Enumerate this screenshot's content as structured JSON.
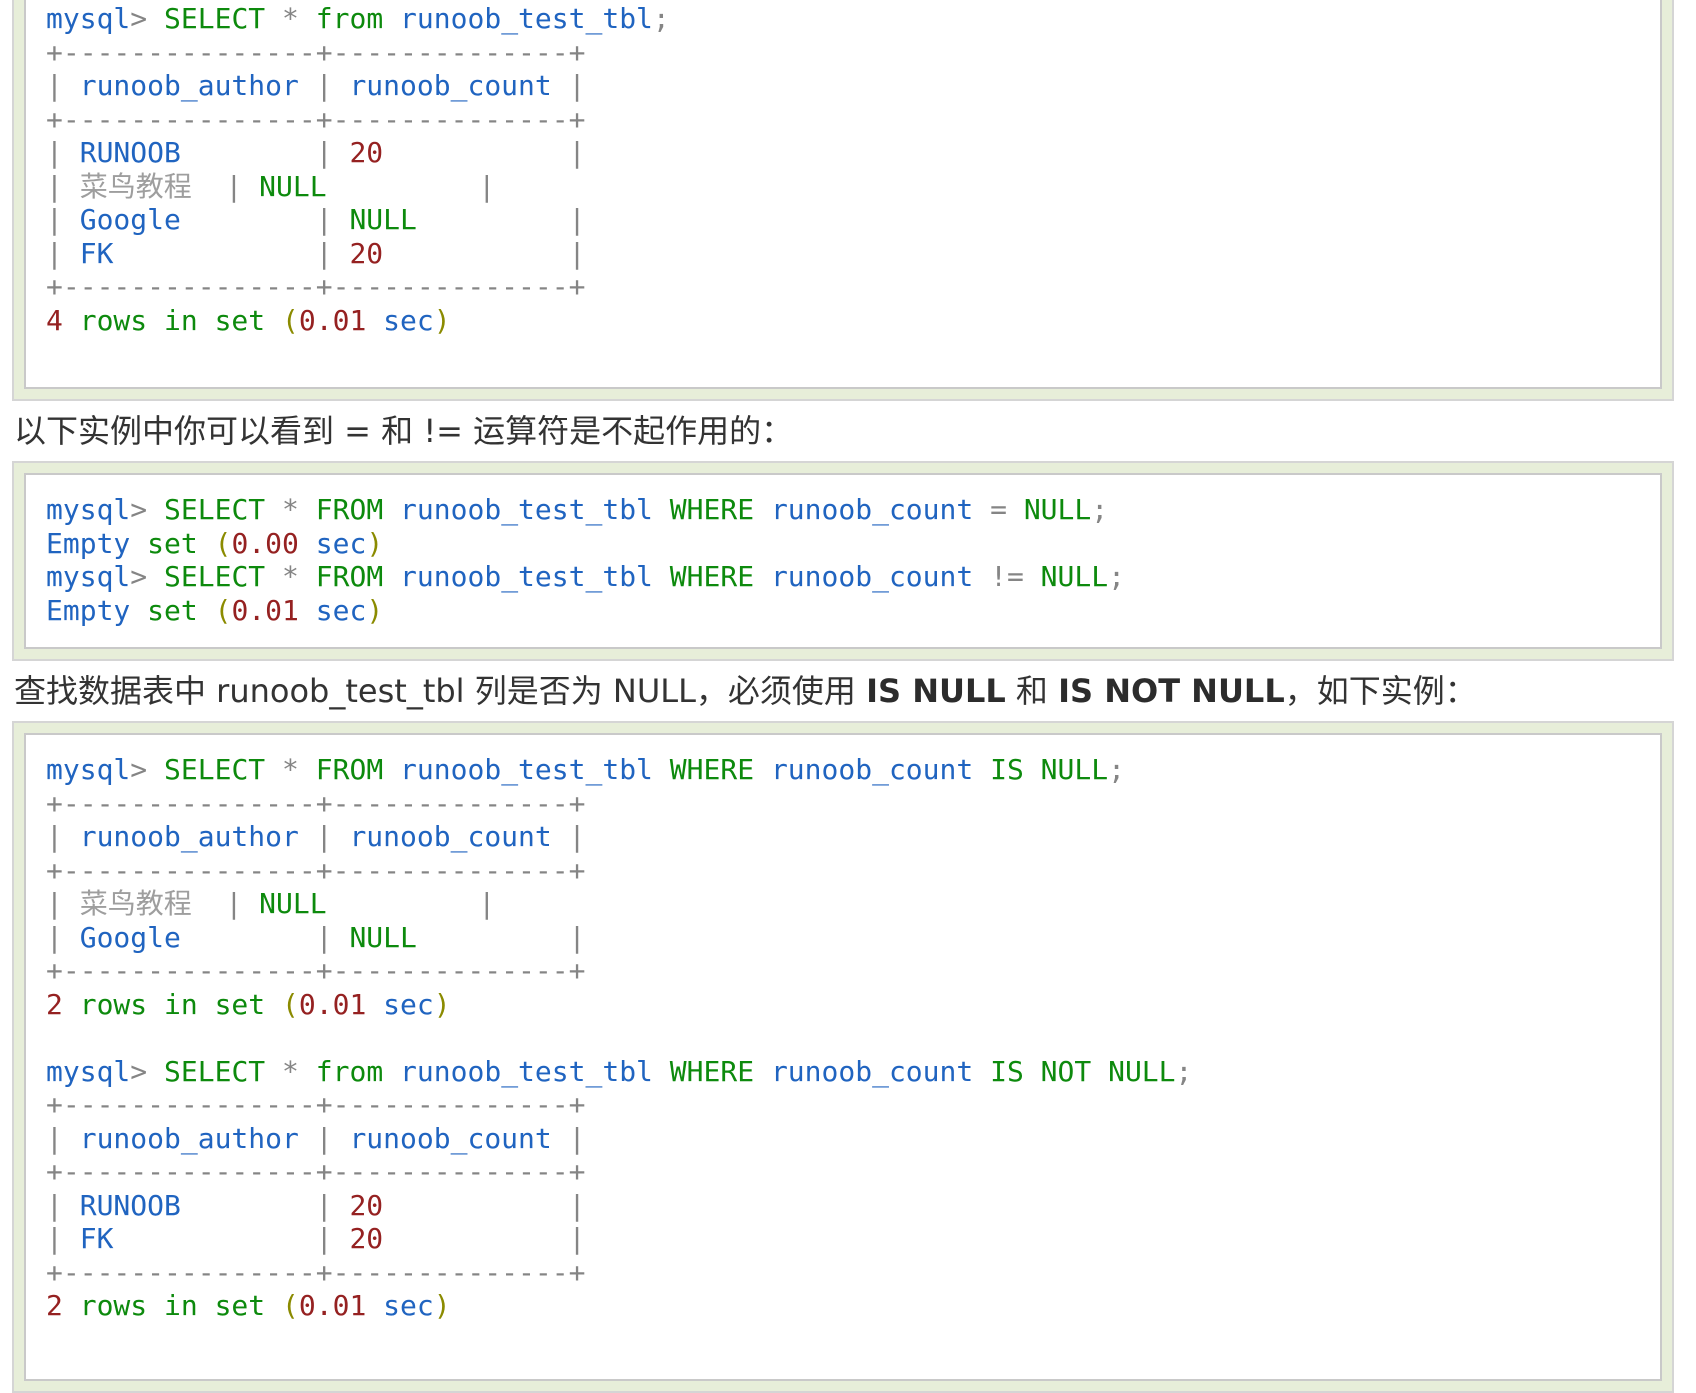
{
  "colors": {
    "identifier_blue": "#2064c0",
    "keyword_green": "#0d8a0d",
    "number_red": "#952121",
    "paren_olive": "#8b8b00",
    "punct_gray": "#858585",
    "cjk_gray": "#9e9e9e",
    "box_bg": "#e7eed9",
    "box_border": "#d5d5d5",
    "pre_border": "#c9c9c9"
  },
  "paragraphs": {
    "operators_note": [
      {
        "t": "以下实例中你可以看到 = 和 != 运算符是不起作用的："
      }
    ],
    "isnull_note": [
      {
        "t": "查找数据表中 runoob_test_tbl 列是否为 NULL，必须使用 "
      },
      {
        "t": "IS NULL",
        "b": true
      },
      {
        "t": " 和 "
      },
      {
        "t": "IS NOT NULL",
        "b": true
      },
      {
        "t": "，如下实例："
      }
    ]
  },
  "code_blocks": [
    {
      "name": "mysql-output-select-all",
      "lines": [
        [
          {
            "c": "b",
            "t": "mysql"
          },
          {
            "c": "p",
            "t": "> "
          },
          {
            "c": "g",
            "t": "SELECT"
          },
          {
            "c": "p",
            "t": " * "
          },
          {
            "c": "g",
            "t": "from"
          },
          {
            "c": "p",
            "t": " "
          },
          {
            "c": "b",
            "t": "runoob_test_tbl"
          },
          {
            "c": "p",
            "t": ";"
          }
        ],
        [
          {
            "c": "p",
            "t": "+---------------+--------------+"
          }
        ],
        [
          {
            "c": "p",
            "t": "| "
          },
          {
            "c": "b",
            "t": "runoob_author"
          },
          {
            "c": "p",
            "t": " | "
          },
          {
            "c": "b",
            "t": "runoob_count"
          },
          {
            "c": "p",
            "t": " |"
          }
        ],
        [
          {
            "c": "p",
            "t": "+---------------+--------------+"
          }
        ],
        [
          {
            "c": "p",
            "t": "| "
          },
          {
            "c": "b",
            "t": "RUNOOB"
          },
          {
            "c": "p",
            "t": "        | "
          },
          {
            "c": "r",
            "t": "20"
          },
          {
            "c": "p",
            "t": "           |"
          }
        ],
        [
          {
            "c": "p",
            "t": "| "
          },
          {
            "c": "y",
            "t": "菜鸟教程"
          },
          {
            "c": "p",
            "t": "  | "
          },
          {
            "c": "g",
            "t": "NULL"
          },
          {
            "c": "p",
            "t": "         |"
          }
        ],
        [
          {
            "c": "p",
            "t": "| "
          },
          {
            "c": "b",
            "t": "Google"
          },
          {
            "c": "p",
            "t": "        | "
          },
          {
            "c": "g",
            "t": "NULL"
          },
          {
            "c": "p",
            "t": "         |"
          }
        ],
        [
          {
            "c": "p",
            "t": "| "
          },
          {
            "c": "b",
            "t": "FK"
          },
          {
            "c": "p",
            "t": "            | "
          },
          {
            "c": "r",
            "t": "20"
          },
          {
            "c": "p",
            "t": "           |"
          }
        ],
        [
          {
            "c": "p",
            "t": "+---------------+--------------+"
          }
        ],
        [
          {
            "c": "r",
            "t": "4"
          },
          {
            "c": "g",
            "t": " rows in set "
          },
          {
            "c": "o",
            "t": "("
          },
          {
            "c": "r",
            "t": "0.01"
          },
          {
            "c": "b",
            "t": " sec"
          },
          {
            "c": "o",
            "t": ")"
          }
        ]
      ]
    },
    {
      "name": "mysql-output-equal-null",
      "lines": [
        [
          {
            "c": "b",
            "t": "mysql"
          },
          {
            "c": "p",
            "t": "> "
          },
          {
            "c": "g",
            "t": "SELECT"
          },
          {
            "c": "p",
            "t": " * "
          },
          {
            "c": "g",
            "t": "FROM"
          },
          {
            "c": "p",
            "t": " "
          },
          {
            "c": "b",
            "t": "runoob_test_tbl"
          },
          {
            "c": "p",
            "t": " "
          },
          {
            "c": "g",
            "t": "WHERE"
          },
          {
            "c": "p",
            "t": " "
          },
          {
            "c": "b",
            "t": "runoob_count"
          },
          {
            "c": "p",
            "t": " = "
          },
          {
            "c": "g",
            "t": "NULL"
          },
          {
            "c": "p",
            "t": ";"
          }
        ],
        [
          {
            "c": "b",
            "t": "Empty"
          },
          {
            "c": "g",
            "t": " set "
          },
          {
            "c": "o",
            "t": "("
          },
          {
            "c": "r",
            "t": "0.00"
          },
          {
            "c": "b",
            "t": " sec"
          },
          {
            "c": "o",
            "t": ")"
          }
        ],
        [
          {
            "c": "b",
            "t": "mysql"
          },
          {
            "c": "p",
            "t": "> "
          },
          {
            "c": "g",
            "t": "SELECT"
          },
          {
            "c": "p",
            "t": " * "
          },
          {
            "c": "g",
            "t": "FROM"
          },
          {
            "c": "p",
            "t": " "
          },
          {
            "c": "b",
            "t": "runoob_test_tbl"
          },
          {
            "c": "p",
            "t": " "
          },
          {
            "c": "g",
            "t": "WHERE"
          },
          {
            "c": "p",
            "t": " "
          },
          {
            "c": "b",
            "t": "runoob_count"
          },
          {
            "c": "p",
            "t": " != "
          },
          {
            "c": "g",
            "t": "NULL"
          },
          {
            "c": "p",
            "t": ";"
          }
        ],
        [
          {
            "c": "b",
            "t": "Empty"
          },
          {
            "c": "g",
            "t": " set "
          },
          {
            "c": "o",
            "t": "("
          },
          {
            "c": "r",
            "t": "0.01"
          },
          {
            "c": "b",
            "t": " sec"
          },
          {
            "c": "o",
            "t": ")"
          }
        ]
      ]
    },
    {
      "name": "mysql-output-is-null",
      "lines": [
        [
          {
            "c": "b",
            "t": "mysql"
          },
          {
            "c": "p",
            "t": "> "
          },
          {
            "c": "g",
            "t": "SELECT"
          },
          {
            "c": "p",
            "t": " * "
          },
          {
            "c": "g",
            "t": "FROM"
          },
          {
            "c": "p",
            "t": " "
          },
          {
            "c": "b",
            "t": "runoob_test_tbl"
          },
          {
            "c": "p",
            "t": " "
          },
          {
            "c": "g",
            "t": "WHERE"
          },
          {
            "c": "p",
            "t": " "
          },
          {
            "c": "b",
            "t": "runoob_count"
          },
          {
            "c": "p",
            "t": " "
          },
          {
            "c": "g",
            "t": "IS NULL"
          },
          {
            "c": "p",
            "t": ";"
          }
        ],
        [
          {
            "c": "p",
            "t": "+---------------+--------------+"
          }
        ],
        [
          {
            "c": "p",
            "t": "| "
          },
          {
            "c": "b",
            "t": "runoob_author"
          },
          {
            "c": "p",
            "t": " | "
          },
          {
            "c": "b",
            "t": "runoob_count"
          },
          {
            "c": "p",
            "t": " |"
          }
        ],
        [
          {
            "c": "p",
            "t": "+---------------+--------------+"
          }
        ],
        [
          {
            "c": "p",
            "t": "| "
          },
          {
            "c": "y",
            "t": "菜鸟教程"
          },
          {
            "c": "p",
            "t": "  | "
          },
          {
            "c": "g",
            "t": "NULL"
          },
          {
            "c": "p",
            "t": "         |"
          }
        ],
        [
          {
            "c": "p",
            "t": "| "
          },
          {
            "c": "b",
            "t": "Google"
          },
          {
            "c": "p",
            "t": "        | "
          },
          {
            "c": "g",
            "t": "NULL"
          },
          {
            "c": "p",
            "t": "         |"
          }
        ],
        [
          {
            "c": "p",
            "t": "+---------------+--------------+"
          }
        ],
        [
          {
            "c": "r",
            "t": "2"
          },
          {
            "c": "g",
            "t": " rows in set "
          },
          {
            "c": "o",
            "t": "("
          },
          {
            "c": "r",
            "t": "0.01"
          },
          {
            "c": "b",
            "t": " sec"
          },
          {
            "c": "o",
            "t": ")"
          }
        ],
        [],
        [
          {
            "c": "b",
            "t": "mysql"
          },
          {
            "c": "p",
            "t": "> "
          },
          {
            "c": "g",
            "t": "SELECT"
          },
          {
            "c": "p",
            "t": " * "
          },
          {
            "c": "g",
            "t": "from"
          },
          {
            "c": "p",
            "t": " "
          },
          {
            "c": "b",
            "t": "runoob_test_tbl"
          },
          {
            "c": "p",
            "t": " "
          },
          {
            "c": "g",
            "t": "WHERE"
          },
          {
            "c": "p",
            "t": " "
          },
          {
            "c": "b",
            "t": "runoob_count"
          },
          {
            "c": "p",
            "t": " "
          },
          {
            "c": "g",
            "t": "IS NOT NULL"
          },
          {
            "c": "p",
            "t": ";"
          }
        ],
        [
          {
            "c": "p",
            "t": "+---------------+--------------+"
          }
        ],
        [
          {
            "c": "p",
            "t": "| "
          },
          {
            "c": "b",
            "t": "runoob_author"
          },
          {
            "c": "p",
            "t": " | "
          },
          {
            "c": "b",
            "t": "runoob_count"
          },
          {
            "c": "p",
            "t": " |"
          }
        ],
        [
          {
            "c": "p",
            "t": "+---------------+--------------+"
          }
        ],
        [
          {
            "c": "p",
            "t": "| "
          },
          {
            "c": "b",
            "t": "RUNOOB"
          },
          {
            "c": "p",
            "t": "        | "
          },
          {
            "c": "r",
            "t": "20"
          },
          {
            "c": "p",
            "t": "           |"
          }
        ],
        [
          {
            "c": "p",
            "t": "| "
          },
          {
            "c": "b",
            "t": "FK"
          },
          {
            "c": "p",
            "t": "            | "
          },
          {
            "c": "r",
            "t": "20"
          },
          {
            "c": "p",
            "t": "           |"
          }
        ],
        [
          {
            "c": "p",
            "t": "+---------------+--------------+"
          }
        ],
        [
          {
            "c": "r",
            "t": "2"
          },
          {
            "c": "g",
            "t": " rows in set "
          },
          {
            "c": "o",
            "t": "("
          },
          {
            "c": "r",
            "t": "0.01"
          },
          {
            "c": "b",
            "t": " sec"
          },
          {
            "c": "o",
            "t": ")"
          }
        ]
      ]
    }
  ]
}
